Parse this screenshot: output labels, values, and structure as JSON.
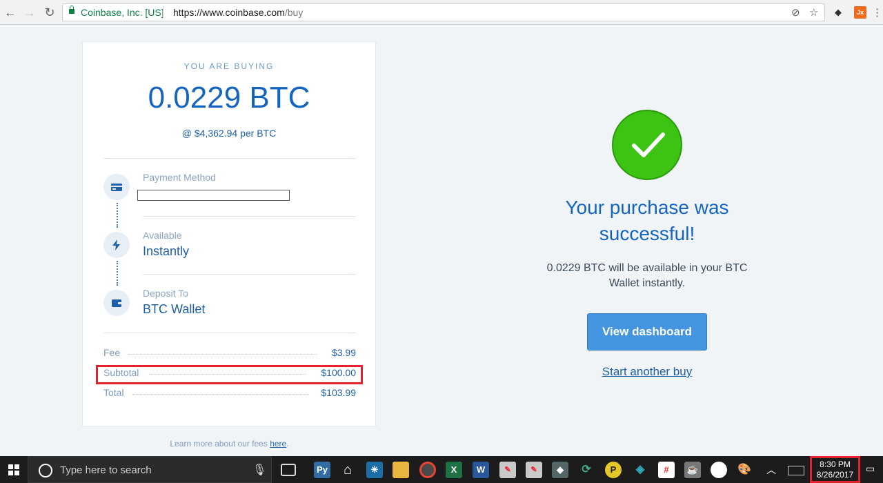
{
  "browser": {
    "ev_name": "Coinbase, Inc. [US]",
    "url_host": "https://www.coinbase.com",
    "url_path": "/buy",
    "ext_jx": "Jx"
  },
  "purchase": {
    "buying_label": "YOU ARE BUYING",
    "amount": "0.0229 BTC",
    "rate": "@ $4,362.94 per BTC"
  },
  "steps": {
    "payment_label": "Payment Method",
    "available_label": "Available",
    "available_value": "Instantly",
    "deposit_label": "Deposit To",
    "deposit_value": "BTC Wallet"
  },
  "fees": {
    "fee_label": "Fee",
    "fee_value": "$3.99",
    "subtotal_label": "Subtotal",
    "subtotal_value": "$100.00",
    "total_label": "Total",
    "total_value": "$103.99",
    "learn_text": "Learn more about our fees ",
    "learn_link": "here",
    "learn_end": "."
  },
  "success": {
    "headline": "Your purchase was successful!",
    "subtext": "0.0229 BTC will be available in your BTC Wallet instantly.",
    "dashboard_button": "View dashboard",
    "another_link": "Start another buy"
  },
  "taskbar": {
    "search_placeholder": "Type here to search",
    "time": "8:30 PM",
    "date": "8/26/2017"
  },
  "colors": {
    "accent": "#1565c0",
    "success": "#3cc314",
    "button": "#4594e0",
    "highlight": "#e5222b"
  }
}
